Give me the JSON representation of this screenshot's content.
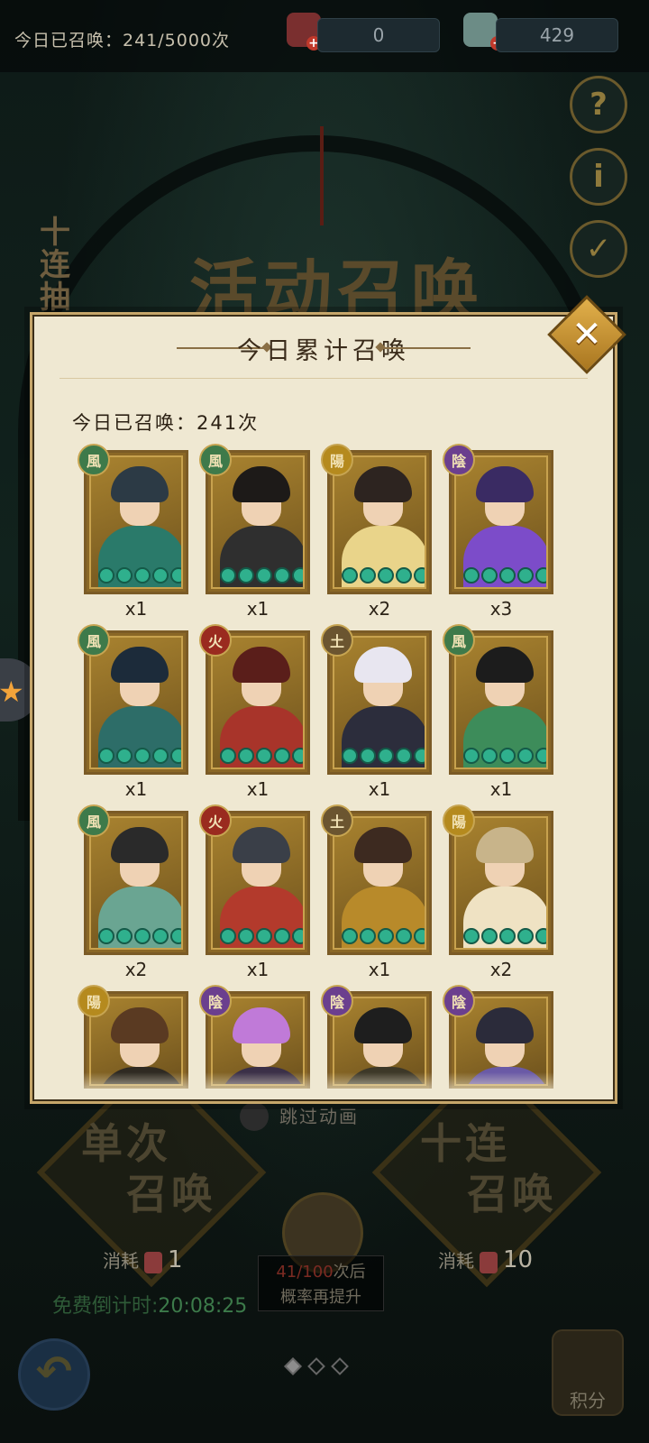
{
  "header": {
    "today_summoned": "今日已召唤：241/5000次",
    "resource_1": "0",
    "resource_2": "429"
  },
  "side_buttons": {
    "help": "?",
    "info": "i",
    "check": "✓"
  },
  "background": {
    "side_banner": "十连抽",
    "big_title": "活动召唤"
  },
  "modal": {
    "title": "今日累计召唤",
    "summary": "今日已召唤：241次",
    "cards": [
      {
        "badge": "風",
        "qty": "x1",
        "color": "#3e7a4a"
      },
      {
        "badge": "風",
        "qty": "x1",
        "color": "#3e7a4a"
      },
      {
        "badge": "陽",
        "qty": "x2",
        "color": "#b58a1e"
      },
      {
        "badge": "陰",
        "qty": "x3",
        "color": "#6b3f8e"
      },
      {
        "badge": "風",
        "qty": "x1",
        "color": "#3e7a4a"
      },
      {
        "badge": "火",
        "qty": "x1",
        "color": "#9a2b1f"
      },
      {
        "badge": "土",
        "qty": "x1",
        "color": "#6b5530"
      },
      {
        "badge": "風",
        "qty": "x1",
        "color": "#3e7a4a"
      },
      {
        "badge": "風",
        "qty": "x2",
        "color": "#3e7a4a"
      },
      {
        "badge": "火",
        "qty": "x1",
        "color": "#9a2b1f"
      },
      {
        "badge": "土",
        "qty": "x1",
        "color": "#6b5530"
      },
      {
        "badge": "陽",
        "qty": "x2",
        "color": "#b58a1e"
      },
      {
        "badge": "陽",
        "qty": "",
        "color": "#b58a1e"
      },
      {
        "badge": "陰",
        "qty": "",
        "color": "#6b3f8e"
      },
      {
        "badge": "陰",
        "qty": "",
        "color": "#6b3f8e"
      },
      {
        "badge": "陰",
        "qty": "",
        "color": "#6b3f8e"
      }
    ]
  },
  "controls": {
    "skip_animation": "跳过动画",
    "single": {
      "line1": "单次",
      "line2": "召唤",
      "cost_label": "消耗",
      "cost": "1"
    },
    "ten": {
      "line1": "十连",
      "line2": "召唤",
      "cost_label": "消耗",
      "cost": "10"
    },
    "countdown_label": "免费倒计时:",
    "countdown_value": "20:08:25",
    "prob_count": "41/100",
    "prob_suffix": "次后",
    "prob_line2": "概率再提升",
    "score_label": "积分"
  }
}
